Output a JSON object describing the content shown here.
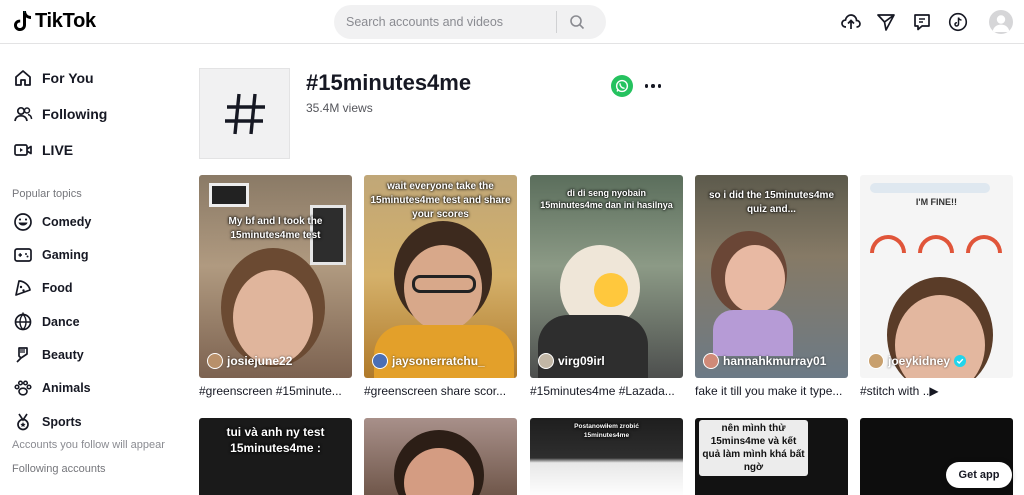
{
  "header": {
    "logo_text": "TikTok",
    "search_placeholder": "Search accounts and videos",
    "icons": [
      "upload-cloud-icon",
      "send-icon",
      "message-icon",
      "tiktok-circle-icon",
      "profile-avatar"
    ]
  },
  "sidebar": {
    "nav": [
      {
        "label": "For You",
        "icon": "home-icon"
      },
      {
        "label": "Following",
        "icon": "people-icon"
      },
      {
        "label": "LIVE",
        "icon": "live-icon"
      }
    ],
    "popular_heading": "Popular topics",
    "topics": [
      {
        "label": "Comedy",
        "icon": "smile-icon"
      },
      {
        "label": "Gaming",
        "icon": "gamepad-icon"
      },
      {
        "label": "Food",
        "icon": "pizza-icon"
      },
      {
        "label": "Dance",
        "icon": "globe-icon"
      },
      {
        "label": "Beauty",
        "icon": "brush-icon"
      },
      {
        "label": "Animals",
        "icon": "paw-icon"
      },
      {
        "label": "Sports",
        "icon": "medal-icon"
      }
    ],
    "following_heading": "Following accounts",
    "following_note": "Accounts you follow will appear"
  },
  "hashtag": {
    "title": "#15minutes4me",
    "views": "35.4M views"
  },
  "videos": [
    {
      "username": "josiejune22",
      "caption": "#greenscreen #15minute...",
      "overlay": "My bf and I took the 15minutes4me test",
      "bg": "#a8896b"
    },
    {
      "username": "jaysonerratchu_",
      "caption": "#greenscreen share scor...",
      "overlay": "wait everyone take the 15minutes4me test and share your scores",
      "bg": "#c9a05a"
    },
    {
      "username": "virg09irl",
      "caption": "#15minutes4me #Lazada...",
      "overlay": "di di seng nyobain 15minutes4me dan ini hasilnya",
      "bg": "#6f7a6a"
    },
    {
      "username": "hannahkmurray01",
      "caption": "fake it till you make it type...",
      "overlay": "so i did the 15minutes4me quiz and...",
      "bg": "#7a6a63"
    },
    {
      "username": "joeykidney",
      "caption": "#stitch with ..▶",
      "overlay": "I'M FINE!!",
      "bg": "#f4f4f4"
    }
  ],
  "videos_row2": [
    {
      "overlay": "tui và anh ny test 15minutes4me :",
      "bg": "#1a1a1a"
    },
    {
      "overlay": "",
      "bg": "#8a7266"
    },
    {
      "overlay": "Postanowiłem zrobić 15minutes4me",
      "bg": "#2a2a2a"
    },
    {
      "overlay": "nên mình thử 15mins4me và kết quả làm mình khá bất ngờ",
      "bg": "#121212"
    },
    {
      "overlay": "",
      "bg": "#0d0d0d"
    }
  ],
  "get_app_label": "Get app",
  "colors": {
    "accent": "#fe2c55",
    "whatsapp": "#25c25f",
    "verified": "#20d5ec"
  }
}
